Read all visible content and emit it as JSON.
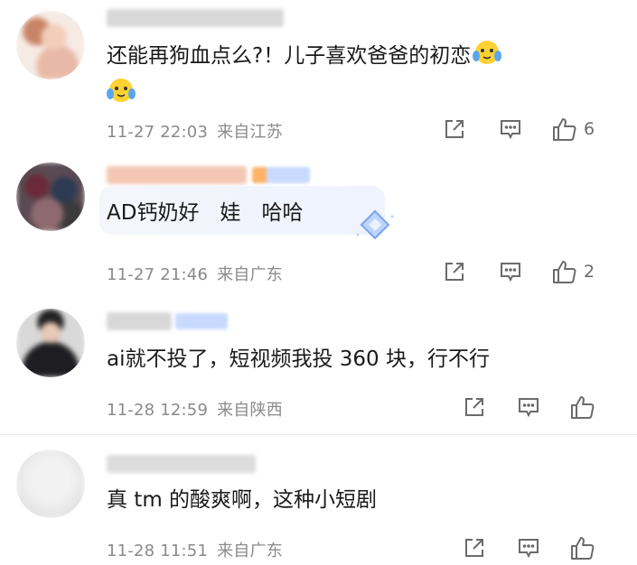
{
  "comments": [
    {
      "text": "还能再狗血点么?！儿子喜欢爸爸的初恋",
      "time": "11-27 22:03",
      "location": "来自江苏",
      "like_count": "6"
    },
    {
      "text": "AD钙奶好　娃　哈哈",
      "time": "11-27 21:46",
      "location": "来自广东",
      "like_count": "2"
    },
    {
      "text": "ai就不投了，短视频我投 360 块，行不行",
      "time": "11-28 12:59",
      "location": "来自陕西",
      "like_count": ""
    },
    {
      "text": "真 tm 的酸爽啊，这种小短剧",
      "time": "11-28 11:51",
      "location": "来自广东",
      "like_count": ""
    }
  ],
  "icons": {
    "share": "share-icon",
    "reply": "comment-icon",
    "like": "thumbs-up-icon",
    "emoji": "crying-face-emoji-icon"
  },
  "colors": {
    "text": "#1a1a1a",
    "meta": "#8a8a8a",
    "icon": "#6b6b6b",
    "badge_blue": "#c9daff"
  }
}
